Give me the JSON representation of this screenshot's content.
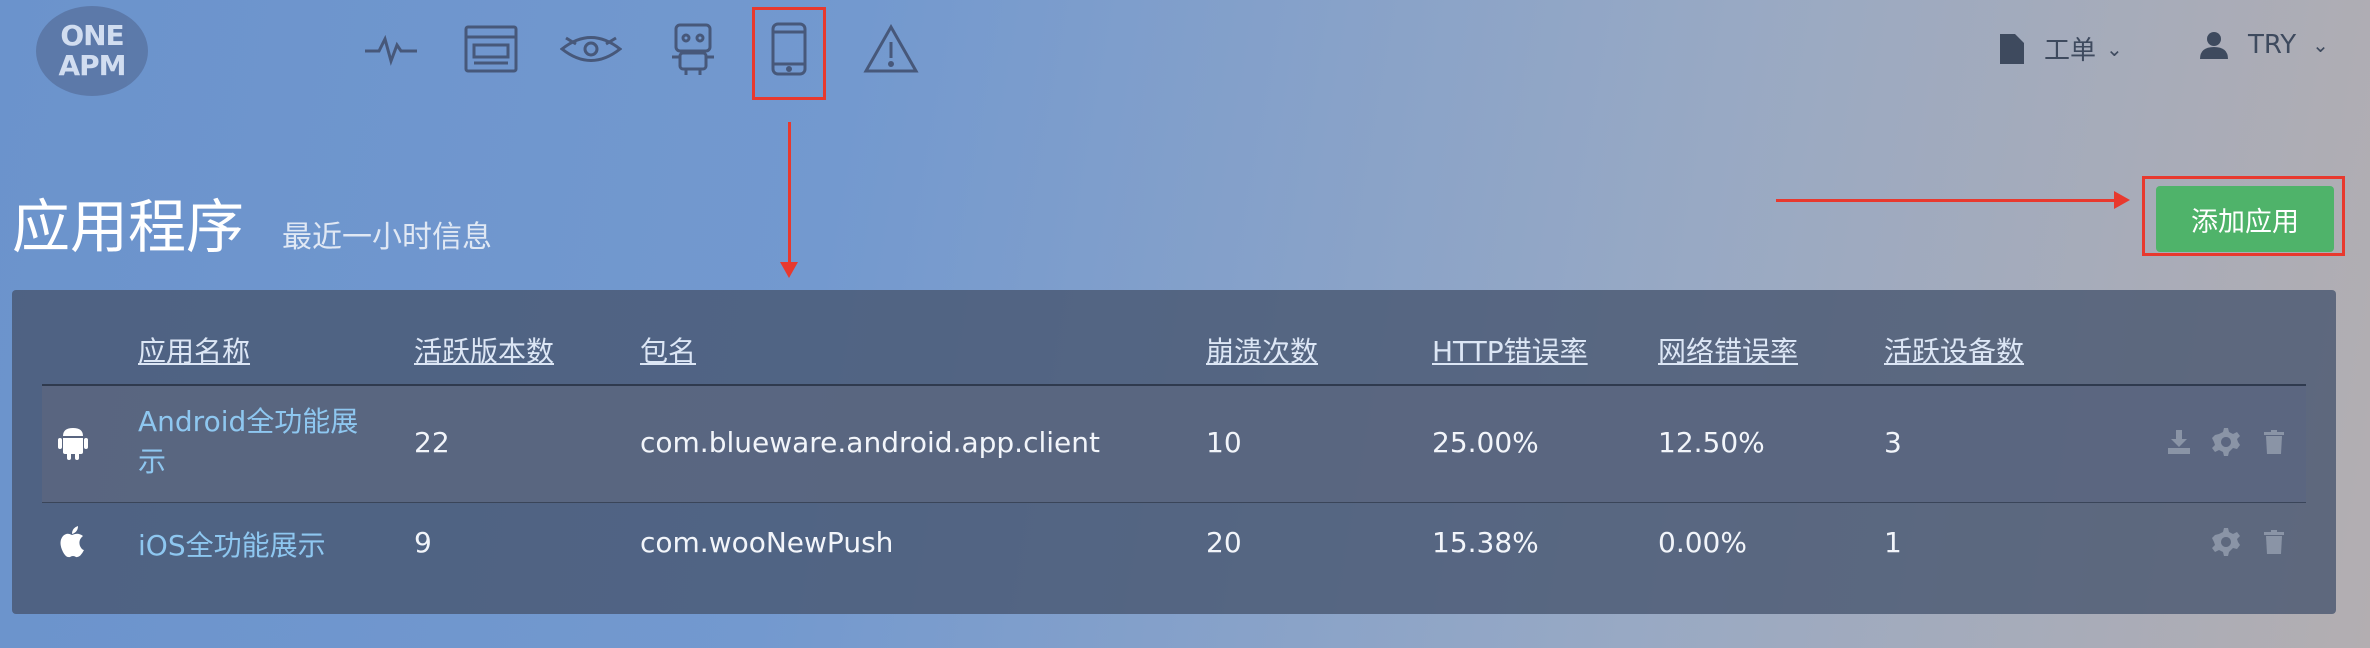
{
  "logo": {
    "line1": "ONE",
    "line2": "APM"
  },
  "nav": {
    "icons": [
      "pulse-icon",
      "browser-icon",
      "eye-icon",
      "robot-icon",
      "mobile-icon",
      "warning-icon"
    ]
  },
  "topbar": {
    "ticket_label": "工单",
    "user_label": "TRY"
  },
  "page": {
    "title": "应用程序",
    "subtitle": "最近一小时信息",
    "add_button": "添加应用"
  },
  "table": {
    "headers": [
      "应用名称",
      "活跃版本数",
      "包名",
      "崩溃次数",
      "HTTP错误率",
      "网络错误率",
      "活跃设备数"
    ],
    "rows": [
      {
        "platform": "android",
        "name": "Android全功能展示",
        "versions": "22",
        "package": "com.blueware.android.app.client",
        "crashes": "10",
        "http_error": "25.00%",
        "net_error": "12.50%",
        "devices": "3"
      },
      {
        "platform": "ios",
        "name": "iOS全功能展示",
        "versions": "9",
        "package": "com.wooNewPush",
        "crashes": "20",
        "http_error": "15.38%",
        "net_error": "0.00%",
        "devices": "1"
      }
    ]
  },
  "colors": {
    "highlight": "#e8392e",
    "add_button": "#4fb36a",
    "link": "#8ec7f0"
  }
}
